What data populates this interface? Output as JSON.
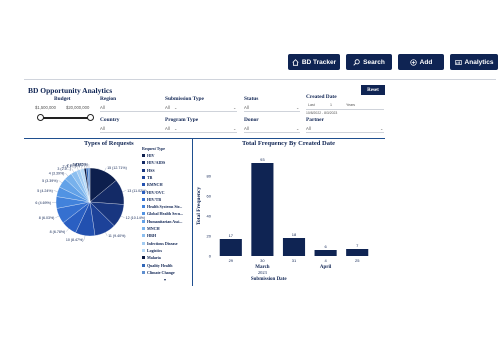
{
  "nav": {
    "buttons": [
      {
        "label": "BD Tracker",
        "icon": "home-icon"
      },
      {
        "label": "Search",
        "icon": "search-icon"
      },
      {
        "label": "Add",
        "icon": "plus-icon"
      },
      {
        "label": "Analytics",
        "icon": "analytics-icon"
      }
    ]
  },
  "dashboard": {
    "title": "BD Opportunity Analytics",
    "reset_label": "Reset",
    "filters": {
      "budget": {
        "label": "Budget",
        "min": "$1,500,000",
        "max": "$20,000,000",
        "min_value": 1500000,
        "max_value": 20000000
      },
      "region": {
        "label": "Region",
        "value": "All"
      },
      "country": {
        "label": "Country",
        "value": "All"
      },
      "submission_type": {
        "label": "Submission Type",
        "value": "All"
      },
      "program_type": {
        "label": "Program Type",
        "value": "All"
      },
      "status": {
        "label": "Status",
        "value": "All"
      },
      "donor": {
        "label": "Donor",
        "value": "All"
      },
      "created_date": {
        "label": "Created Date",
        "mode": "Last",
        "count": "1",
        "unit": "Years",
        "range": "10/8/2022 - 8/3/2023"
      },
      "partner": {
        "label": "Partner",
        "value": "All"
      }
    }
  },
  "pie": {
    "title": "Types of Requests",
    "legend_title": "Request Type",
    "legend": [
      {
        "label": "HIV",
        "color": "#0d1f4d"
      },
      {
        "label": "HIV/AIDS",
        "color": "#132a66"
      },
      {
        "label": "HSS",
        "color": "#183680"
      },
      {
        "label": "TB",
        "color": "#1d4299"
      },
      {
        "label": "RMNCH",
        "color": "#2250b0"
      },
      {
        "label": "HIV/OVC",
        "color": "#2a5fc2"
      },
      {
        "label": "HIV/TB",
        "color": "#3570d0"
      },
      {
        "label": "Health Systems Str...",
        "color": "#4282db"
      },
      {
        "label": "Global Health Secu...",
        "color": "#5193e3"
      },
      {
        "label": "Humanitarian Assi...",
        "color": "#63a2e8"
      },
      {
        "label": "MNCH",
        "color": "#77b1ec"
      },
      {
        "label": "HRH",
        "color": "#8cbff0"
      },
      {
        "label": "Infectious Disease",
        "color": "#a2ccf3"
      },
      {
        "label": "Logistics",
        "color": "#b7d9f6"
      },
      {
        "label": "Malaria",
        "color": "#0a1840"
      },
      {
        "label": "Quality Health",
        "color": "#2f66b8"
      },
      {
        "label": "Climate Change",
        "color": "#5e8fd0"
      }
    ],
    "labels": [
      {
        "text": "15 (12.71%)"
      },
      {
        "text": "13 (11.02%)"
      },
      {
        "text": "12 (10.14%)"
      },
      {
        "text": "11 (9.40%)"
      },
      {
        "text": "10 (8.47%)"
      },
      {
        "text": "8 (6.78%)"
      },
      {
        "text": "8 (6.03%)"
      },
      {
        "text": "6 (4.69%)"
      },
      {
        "text": "5 (4.24%)"
      },
      {
        "text": "5 (3.39%)"
      },
      {
        "text": "4 (3.39%)"
      },
      {
        "text": "3 (2.5...)"
      },
      {
        "text": "2 (1.7...)"
      },
      {
        "text": "2 (1.7...)"
      },
      {
        "text": "1 (1...)"
      },
      {
        "text": "1 (1...)"
      },
      {
        "text": "1 (0.85%)"
      }
    ],
    "more_icon": "chevron-down-icon"
  },
  "chart_data": {
    "type": "bar",
    "title": "Total Frequency By Created Date",
    "xlabel": "Submission Date",
    "ylabel": "Total Frequency",
    "categories": [
      "29",
      "30",
      "31",
      "4",
      "25"
    ],
    "values": [
      17,
      93,
      18,
      6,
      7
    ],
    "month_labels": [
      {
        "label": "March",
        "after_index": 1
      },
      {
        "label": "April",
        "after_index": 3
      }
    ],
    "year_label": "2023",
    "yticks": [
      0,
      20,
      40,
      60,
      80
    ],
    "ylim": [
      0,
      100
    ],
    "bar_color": "#0f2453"
  }
}
